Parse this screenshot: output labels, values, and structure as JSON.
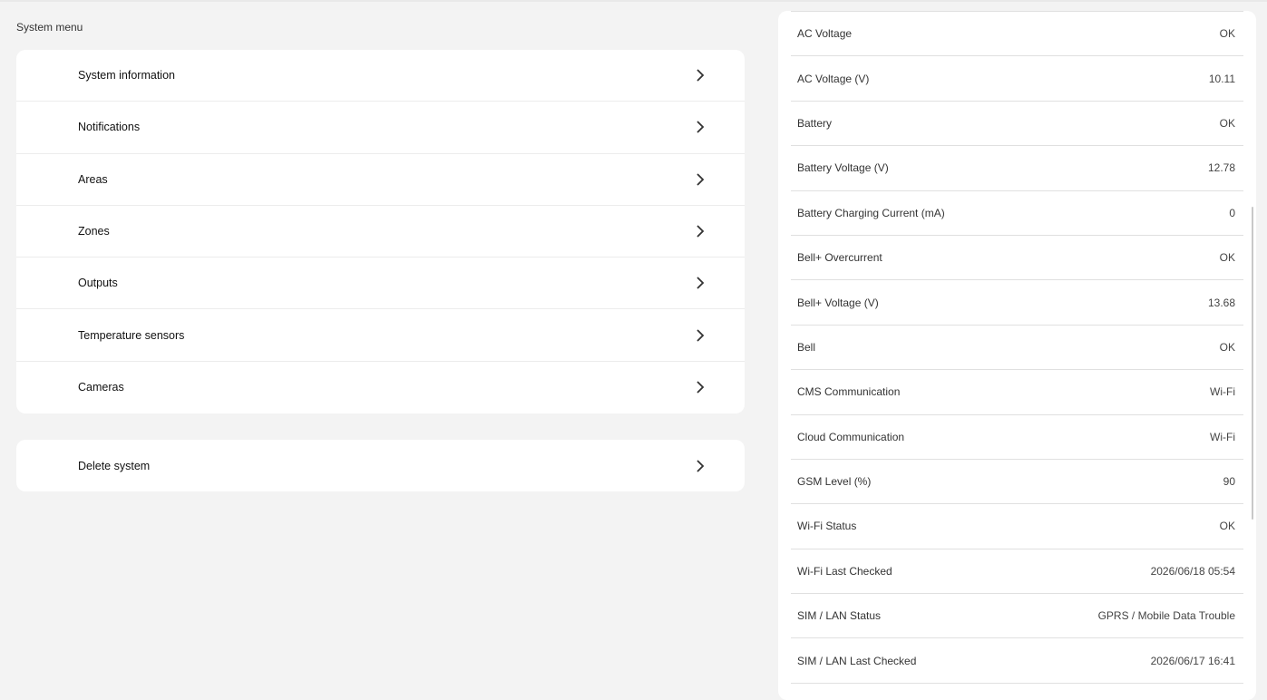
{
  "section_title": "System menu",
  "menu": {
    "items": [
      {
        "label": "System information"
      },
      {
        "label": "Notifications"
      },
      {
        "label": "Areas"
      },
      {
        "label": "Zones"
      },
      {
        "label": "Outputs"
      },
      {
        "label": "Temperature sensors"
      },
      {
        "label": "Cameras"
      }
    ],
    "danger_items": [
      {
        "label": "Delete system"
      }
    ],
    "chevron_icon": "chevron-right-icon"
  },
  "status": {
    "rows": [
      {
        "label": "AC Voltage",
        "value": "OK"
      },
      {
        "label": "AC Voltage (V)",
        "value": "10.11"
      },
      {
        "label": "Battery",
        "value": "OK"
      },
      {
        "label": "Battery Voltage (V)",
        "value": "12.78"
      },
      {
        "label": "Battery Charging Current (mA)",
        "value": "0"
      },
      {
        "label": "Bell+ Overcurrent",
        "value": "OK"
      },
      {
        "label": "Bell+ Voltage (V)",
        "value": "13.68"
      },
      {
        "label": "Bell",
        "value": "OK"
      },
      {
        "label": "CMS Communication",
        "value": "Wi-Fi"
      },
      {
        "label": "Cloud Communication",
        "value": "Wi-Fi"
      },
      {
        "label": "GSM Level (%)",
        "value": "90"
      },
      {
        "label": "Wi-Fi Status",
        "value": "OK"
      },
      {
        "label": "Wi-Fi Last Checked",
        "value": "2026/06/18 05:54"
      },
      {
        "label": "SIM / LAN Status",
        "value": "GPRS / Mobile Data Trouble"
      },
      {
        "label": "SIM / LAN Last Checked",
        "value": "2026/06/17 16:41"
      }
    ]
  }
}
